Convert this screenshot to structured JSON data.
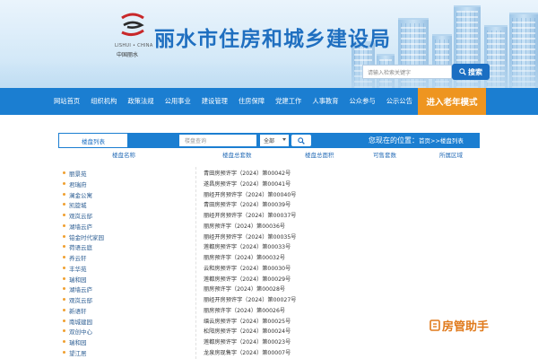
{
  "header": {
    "logo_en": "LISHUI • CHINA",
    "logo_cn": "中国丽水",
    "title": "丽水市住房和城乡建设局",
    "search": {
      "placeholder": "请输入检索关键字",
      "button_label": "搜索"
    }
  },
  "nav": {
    "items": [
      "网站首页",
      "组织机构",
      "政策法规",
      "公用事业",
      "建设管理",
      "住房保障",
      "党建工作",
      "人事教育",
      "公众参与",
      "公示公告"
    ],
    "elder_mode": "进入老年模式"
  },
  "filter": {
    "list_title": "楼盘列表",
    "query_placeholder": "楼盘查询",
    "select_value": "全部",
    "location_label": "您现在的位置：",
    "breadcrumb": "首页>>楼盘列表"
  },
  "table": {
    "headers": [
      "楼盘名称",
      "楼盘总套数",
      "楼盘总面积",
      "可售套数",
      "所属区域"
    ],
    "rows": [
      {
        "name": "丽景苑",
        "permit": "青田房预许字（2024）第00042号"
      },
      {
        "name": "君瑞府",
        "permit": "遂昌房预许字（2024）第00041号"
      },
      {
        "name": "澜金公寓",
        "permit": "丽经开房预许字（2024）第00040号"
      },
      {
        "name": "凯旋城",
        "permit": "青田房预许字（2024）第00039号"
      },
      {
        "name": "观岚云邸",
        "permit": "丽经开房预许字（2024）第00037号"
      },
      {
        "name": "湖墙云庐",
        "permit": "丽房预许字（2024）第00036号"
      },
      {
        "name": "铂金时代家园",
        "permit": "丽经开房预许字（2024）第00035号"
      },
      {
        "name": "荷语云庭",
        "permit": "莲都房预许字（2024）第00033号"
      },
      {
        "name": "养云轩",
        "permit": "丽房预许字（2024）第00032号"
      },
      {
        "name": "丰华苑",
        "permit": "云和房预许字（2024）第00030号"
      },
      {
        "name": "瑞和园",
        "permit": "莲都房预许字（2024）第00029号"
      },
      {
        "name": "湖墙云庐",
        "permit": "丽房预许字（2024）第00028号"
      },
      {
        "name": "观岚云邸",
        "permit": "丽经开房预许字（2024）第00027号"
      },
      {
        "name": "新语轩",
        "permit": "丽房预许字（2024）第00026号"
      },
      {
        "name": "南城建园",
        "permit": "缙云房预许字（2024）第00025号"
      },
      {
        "name": "双创中心",
        "permit": "松阳房预许字（2024）第00024号"
      },
      {
        "name": "瑞和园",
        "permit": "莲都房预许字（2024）第00023号"
      },
      {
        "name": "望江居",
        "permit": "龙泉房现售字（2024）第00007号"
      }
    ]
  },
  "watermark": "房管助手",
  "colors": {
    "nav_blue": "#1b7ed1",
    "elder_orange": "#ee9520",
    "title_blue": "#1f6fc0"
  }
}
